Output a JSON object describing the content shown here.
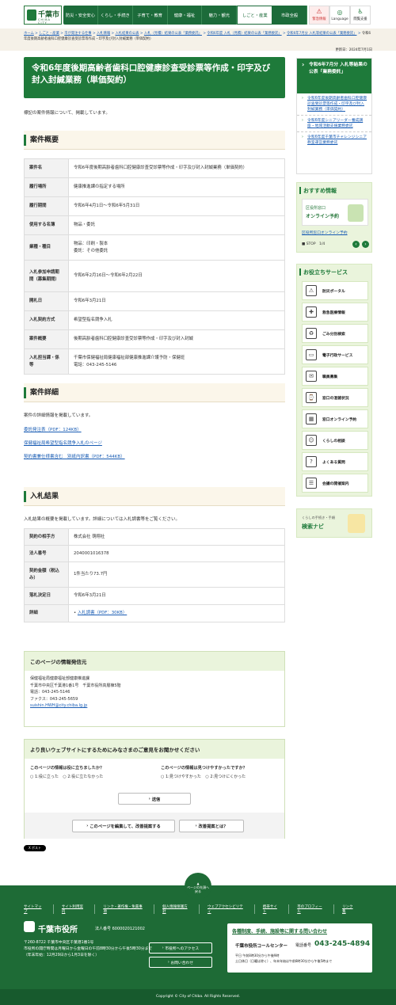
{
  "header": {
    "logo_main": "千葉市",
    "logo_sub": "CHIBA CITY",
    "nav": [
      "防災・安全安心",
      "くらし・手続き",
      "子育て・教育",
      "健康・福祉",
      "魅力・観光",
      "しごと・産業",
      "市政全般"
    ],
    "tools": [
      {
        "label": "緊急情報",
        "icon": "warning-icon"
      },
      {
        "label": "Language",
        "icon": "globe-icon"
      },
      {
        "label": "閲覧支援",
        "icon": "accessibility-icon"
      }
    ]
  },
  "breadcrumb": [
    "ホーム",
    "しごと・産業",
    "市が発注する仕事",
    "入札情報",
    "入札結果の公表",
    "入札（見積）結果の公表「業務委託」",
    "令和6年度 入札（見積）結果の公表「業務委託」",
    "令和6年7月分 入札等結果の公表「業務委託」",
    "令和6年度後期高齢者歯科口腔健康診査受診票等作成・印字及び封入封緘業務（単価契約）"
  ],
  "updated": "更新日：2024年7月1日",
  "page_title": "令和6年度後期高齢者歯科口腔健康診査受診票等作成・印字及び封入封緘業務（単価契約）",
  "intro": "標記の案件情報について、掲載しています。",
  "sections": {
    "summary": "案件概要",
    "detail": "案件詳細",
    "result": "入札結果"
  },
  "summary_rows": [
    {
      "k": "案件名",
      "v": "令和6年度後期高齢者歯科口腔健康診査受診票等作成・印字及び封入封緘業務（単価契約）"
    },
    {
      "k": "履行場所",
      "v": "健康推進課の指定する場所"
    },
    {
      "k": "履行期間",
      "v": "令和6年4月1日～令和6年5月31日"
    },
    {
      "k": "使用する名簿",
      "v": "物品・委託"
    },
    {
      "k": "業種・種目",
      "v": "物品：印刷・製本",
      "v2": "委託：その他委託"
    },
    {
      "k": "入札参加申請期間（募集期間）",
      "v": "令和6年2月16日～令和6年2月22日"
    },
    {
      "k": "開札日",
      "v": "令和6年3月21日"
    },
    {
      "k": "入札契約方式",
      "v": "希望型指名競争入札"
    },
    {
      "k": "案件概要",
      "v": "後期高齢者歯科口腔健康診査受診票等作成・印字及び封入封緘"
    },
    {
      "k": "入札担当課・係等",
      "v": "千葉市保健福祉局健康福祉部健康推進課介護予防・保健班",
      "v2": "電話：043-245-5146"
    }
  ],
  "detail_text": "案件の詳細情報を掲載しています。",
  "detail_links": [
    "委託発注表（PDF：124KB）",
    "保健福祉局希望型指名競争入札のページ",
    "契約書兼仕様書含む　別紙内訳書（PDF：544KB）"
  ],
  "result_text": "入札結果の概要を掲載しています。詳細については入札調書等をご覧ください。",
  "result_rows": [
    {
      "k": "契約の相手方",
      "v": "株式会社 萌翔社"
    },
    {
      "k": "法人番号",
      "v": "2040001016378"
    },
    {
      "k": "契約金額（税込み）",
      "v": "1件当たり73.7円"
    },
    {
      "k": "落札決定日",
      "v": "令和6年3月21日"
    },
    {
      "k": "詳細",
      "v": "入札調書（PDF：30KB）"
    }
  ],
  "info_box": {
    "title": "このページの情報発信元",
    "lines": [
      "保健福祉局健康福祉部健康推進課",
      "千葉市中央区千葉港1番1号　千葉市役所高層棟5階",
      "電話：043-245-5146",
      "ファクス：043-245-5659"
    ],
    "email": "suishin.HWH@city.chiba.lg.jp"
  },
  "survey": {
    "title": "より良いウェブサイトにするためにみなさまのご意見をお聞かせください",
    "q1": "このページの情報は役に立ちましたか？",
    "q1_opts": [
      "1:役に立った",
      "2:役に立たなかった"
    ],
    "q2": "このページの情報は見つけやすかったですか？",
    "q2_opts": [
      "1:見つけやすかった",
      "2:見つけにくかった"
    ],
    "submit": "送信",
    "edit_btn": "このページを編集して、改善提案する",
    "improve_btn": "改善提案とは？"
  },
  "x_post": "X ポスト",
  "sidebar": {
    "current_title": "令和6年7月分 入札等結果の公表「業務委託」",
    "current_items": [
      "令和6年度後期高齢者歯科口腔健康診査受診票等作成・印字及び封入封緘業務（単価契約）",
      "令和6年度シニアリーダー養成講座・地域活動支援業務委託",
      "令和6年度千葉市チャレンジシニア教室運営業務委託"
    ],
    "recommend_title": "おすすめ情報",
    "banner_line1": "区役所窓口",
    "banner_line2": "オンライン予約",
    "recommend_link": "区役所窓口オンライン予約",
    "stop_label": "STOP",
    "pager": "1/4",
    "services_title": "お役立ちサービス",
    "services": [
      {
        "label": "防災ポータル",
        "icon": "disaster-icon"
      },
      {
        "label": "救急医療情報",
        "icon": "ambulance-icon"
      },
      {
        "label": "ごみ分別検索",
        "icon": "trash-icon"
      },
      {
        "label": "電子行政サービス",
        "icon": "pc-icon"
      },
      {
        "label": "職員募集",
        "icon": "recruit-icon"
      },
      {
        "label": "窓口の混雑状況",
        "icon": "crowd-icon"
      },
      {
        "label": "窓口オンライン予約",
        "icon": "calendar-icon"
      },
      {
        "label": "くらしの相談",
        "icon": "consult-icon"
      },
      {
        "label": "よくある質問",
        "icon": "question-icon"
      },
      {
        "label": "会議の開催案内",
        "icon": "meeting-icon"
      }
    ],
    "navi_small": "くらしの手続き・手順",
    "navi_title": "検索ナビ"
  },
  "footer": {
    "pagetop": "ページの先頭へ戻る",
    "links": [
      "サイトマップ",
      "サイト利用案内",
      "リンク・著作権・免責事項",
      "個人情報保護方針",
      "ウェブアクセシビリティ",
      "携帯サイト",
      "市のプロフィール",
      "リンク集"
    ],
    "office": "千葉市役所",
    "corp_no": "法人番号 6000020121002",
    "addr": "〒260-8722 千葉市中央区千葉港1番1号",
    "hours": "市役所の開庁時間は月曜日から金曜日の午前8時30分から午後5時30分まで",
    "closed": "（年末年始：12月29日から1月3日を除く）",
    "access_btn": "市役所へのアクセス",
    "contact_btn": "お問い合わせ",
    "call_title": "各種制度、手続、施設等に関する問い合わせ",
    "call_center": "千葉市役所コールセンター",
    "call_label": "電話番号",
    "call_number": "043-245-4894",
    "call_hours1": "平日 午前8時30分から午後9時",
    "call_hours2": "土日休日（日曜は除く）、年末年始は午前8時30分から午後5時まで",
    "copyright": "Copyright © City of Chiba. All Rights Reserved."
  }
}
